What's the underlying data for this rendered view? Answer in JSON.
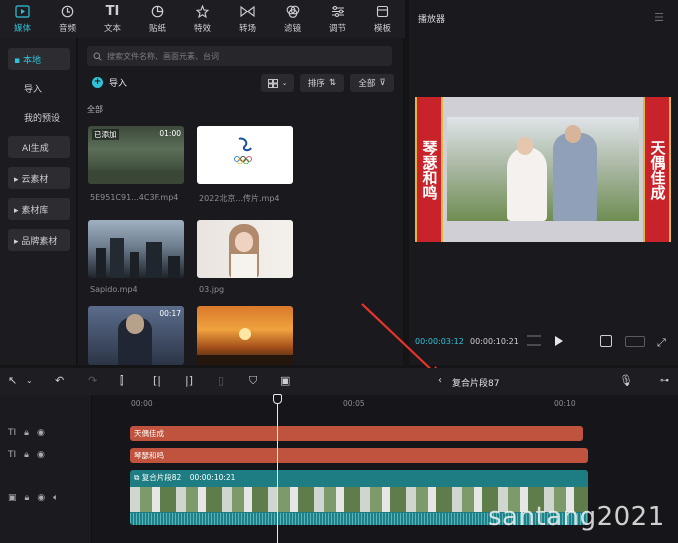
{
  "top_tabs": [
    {
      "label": "媒体",
      "icon": "media-icon"
    },
    {
      "label": "音频",
      "icon": "audio-icon"
    },
    {
      "label": "文本",
      "icon": "text-icon"
    },
    {
      "label": "贴纸",
      "icon": "sticker-icon"
    },
    {
      "label": "特效",
      "icon": "effects-icon"
    },
    {
      "label": "转场",
      "icon": "transition-icon"
    },
    {
      "label": "滤镜",
      "icon": "filter-icon"
    },
    {
      "label": "调节",
      "icon": "adjust-icon"
    },
    {
      "label": "模板",
      "icon": "template-icon"
    }
  ],
  "sidebar": {
    "local": "▪ 本地",
    "import": "导入",
    "my_presets": "我的预设",
    "ai_gen": "AI生成",
    "cloud": "▸ 云素材",
    "library": "▸ 素材库",
    "brand": "▸ 品牌素材"
  },
  "media": {
    "search_placeholder": "搜索文件名称、画面元素、台词",
    "import_label": "导入",
    "sort_label": "排序",
    "all_filter_label": "全部",
    "section_label": "全部",
    "items": [
      {
        "name": "5E951C91...4C3F.mp4",
        "badge": "已添加",
        "duration": "01:00"
      },
      {
        "name": "2022北京...传片.mp4",
        "badge": "",
        "duration": ""
      },
      {
        "name": "Sapido.mp4",
        "badge": "",
        "duration": ""
      },
      {
        "name": "03.jpg",
        "badge": "",
        "duration": ""
      },
      {
        "name": "",
        "badge": "",
        "duration": "00:17"
      },
      {
        "name": "",
        "badge": "",
        "duration": ""
      }
    ]
  },
  "player": {
    "title": "播放器",
    "left_banner": "琴瑟和鸣",
    "right_banner": "天偶佳成",
    "current_time": "00:00:03:12",
    "total_time": "00:00:10:21"
  },
  "toolbar": {
    "breadcrumb": "复合片段87"
  },
  "timeline": {
    "ruler": [
      "00:00",
      "00:05",
      "00:10"
    ],
    "text_clip_1": "天偶佳成",
    "text_clip_2": "琴瑟和鸣",
    "compound_clip_name": "复合片段82",
    "compound_clip_duration": "00:00:10:21"
  },
  "watermark": "santang2021",
  "colors": {
    "accent": "#2fc3d8",
    "text_clip": "#c0533d",
    "compound_clip": "#1e7d82"
  }
}
